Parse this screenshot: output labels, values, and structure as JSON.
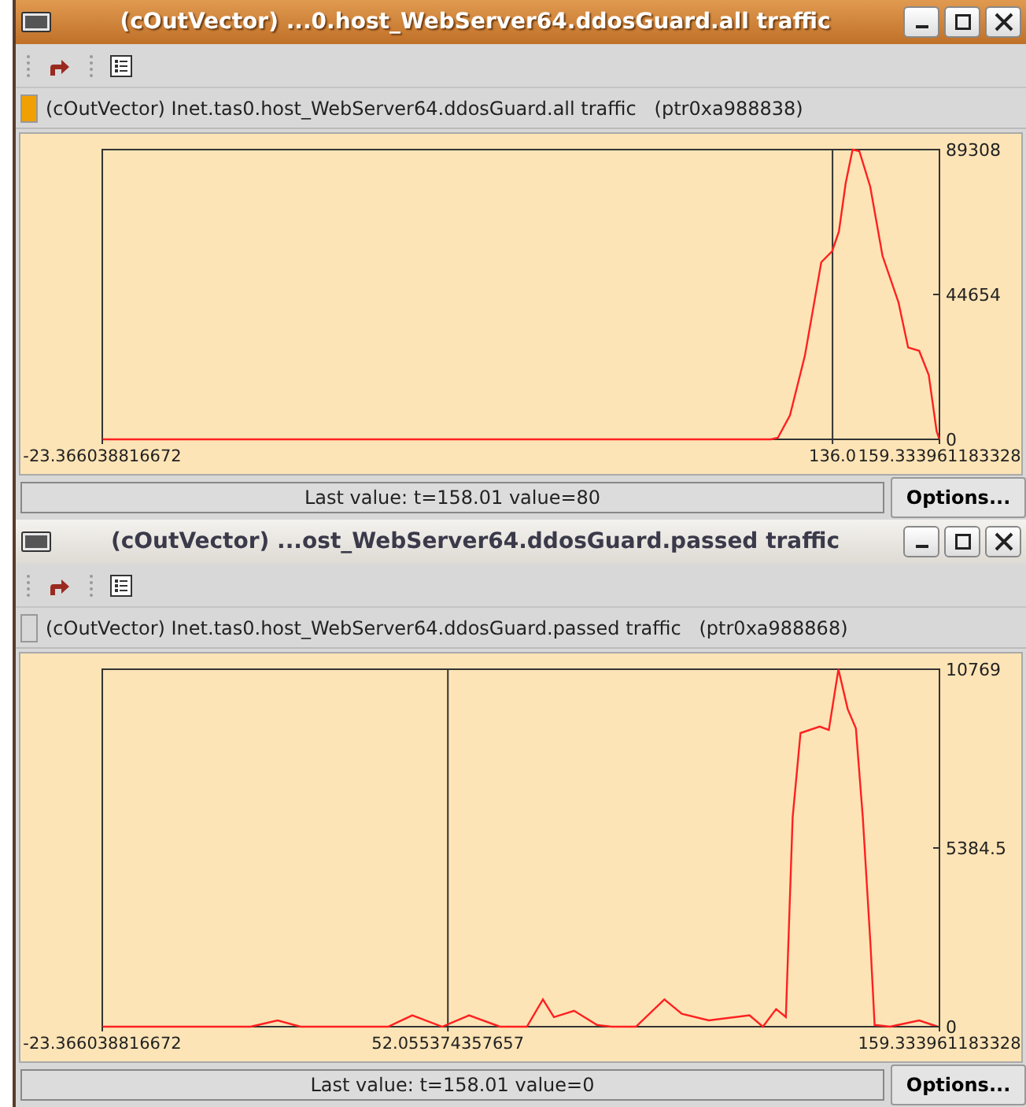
{
  "windows": [
    {
      "title": "(cOutVector) ...0.host_WebServer64.ddosGuard.all traffic",
      "active": true,
      "info": {
        "color": "#f0a000",
        "text": "(cOutVector) Inet.tas0.host_WebServer64.ddosGuard.all traffic   (ptr0xa988838)"
      },
      "chart_data": {
        "type": "line",
        "x": [
          -23.366,
          100,
          120,
          122.56,
          124.05,
          126.71,
          129.98,
          133.54,
          135.91,
          137.4,
          138.88,
          140.36,
          141.85,
          144.22,
          146.9,
          150.4,
          152.5,
          154.9,
          157.0,
          158.7,
          159.33
        ],
        "series": [
          {
            "color": "#ff2020",
            "values": [
              0,
              0,
              0,
              0,
              500,
              7400,
              25800,
              54600,
              58000,
              64000,
              78900,
              89308,
              88800,
              77900,
              56600,
              42200,
              28300,
              27300,
              19800,
              2500,
              0
            ]
          }
        ],
        "xlim": [
          -23.366038816672,
          159.333961183328
        ],
        "ylim": [
          0,
          89308
        ],
        "xticks": [
          {
            "value": -23.366038816672,
            "label": "-23.366038816672"
          },
          {
            "value": 136.0,
            "label": "136.0"
          },
          {
            "value": 159.333961183328,
            "label": "159.333961183328"
          }
        ],
        "yticks": [
          {
            "value": 0,
            "label": "0"
          },
          {
            "value": 44654,
            "label": "44654"
          },
          {
            "value": 89308,
            "label": "89308"
          }
        ],
        "ref_lines": [
          {
            "axis": "x",
            "value": 136.0
          }
        ]
      },
      "status": "Last value: t=158.01   value=80",
      "options": "Options..."
    },
    {
      "title": "(cOutVector) ...ost_WebServer64.ddosGuard.passed traffic",
      "active": false,
      "info": {
        "color": "#d8d8d8",
        "text": "(cOutVector) Inet.tas0.host_WebServer64.ddosGuard.passed traffic   (ptr0xa988868)"
      },
      "chart_data": {
        "type": "line",
        "x": [
          -23.366,
          9.0,
          14.9,
          19.9,
          39.0,
          44.3,
          50.8,
          56.7,
          63.4,
          69.3,
          72.8,
          75.2,
          79.6,
          84.6,
          87.8,
          93.1,
          99.3,
          103.1,
          109.0,
          117.9,
          120.8,
          123.7,
          125.8,
          127.3,
          129.0,
          133.2,
          135.2,
          137.3,
          139.3,
          141.1,
          142.6,
          144.3,
          145.2,
          148.5,
          154.9,
          159.0
        ],
        "series": [
          {
            "color": "#ff2020",
            "values": [
              0,
              0,
              190,
              0,
              0,
              340,
              0,
              340,
              0,
              0,
              820,
              290,
              480,
              50,
              0,
              0,
              820,
              390,
              190,
              340,
              0,
              530,
              290,
              6300,
              8850,
              9040,
              8940,
              10769,
              9570,
              8990,
              6300,
              2450,
              50,
              0,
              190,
              0
            ]
          }
        ],
        "xlim": [
          -23.366038816672,
          159.333961183328
        ],
        "ylim": [
          0,
          10769
        ],
        "xticks": [
          {
            "value": -23.366038816672,
            "label": "-23.366038816672"
          },
          {
            "value": 52.055374357657,
            "label": "52.055374357657"
          },
          {
            "value": 159.333961183328,
            "label": "159.333961183328"
          }
        ],
        "yticks": [
          {
            "value": 0,
            "label": "0"
          },
          {
            "value": 5384.5,
            "label": "5384.5"
          },
          {
            "value": 10769,
            "label": "10769"
          }
        ],
        "ref_lines": [
          {
            "axis": "x",
            "value": 52.055374357657
          }
        ]
      },
      "status": "Last value: t=158.01   value=0",
      "options": "Options..."
    }
  ]
}
